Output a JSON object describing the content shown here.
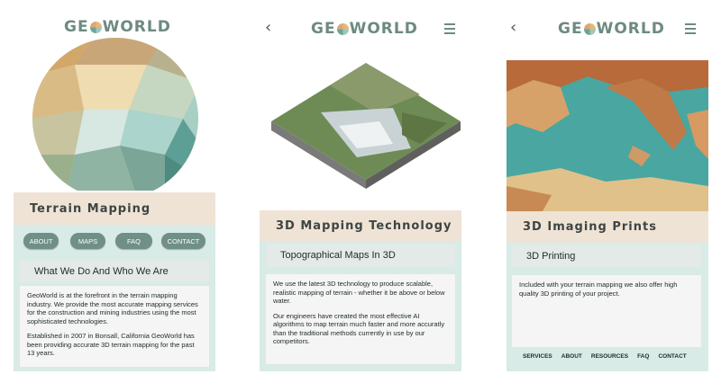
{
  "brand": {
    "prefix": "GE",
    "suffix": "WORLD"
  },
  "screen1": {
    "title": "Terrain Mapping",
    "nav": [
      "ABOUT",
      "MAPS",
      "FAQ",
      "CONTACT"
    ],
    "subheading": "What We Do And Who We Are",
    "paragraphs": [
      "GeoWorld is at the forefront in the terrain mapping industry. We provide the most accurate mapping services for the construction and mining industries using the most sophisticated technologies.",
      "Established in 2007 in Bonsall, California GeoWorld has been providing accurate 3D terrain mapping for the past 13 years."
    ]
  },
  "screen2": {
    "back": "‹",
    "title": "3D Mapping Technology",
    "subheading": "Topographical Maps In 3D",
    "paragraphs": [
      "We use the latest 3D technology to produce scalable, realistic mapping of terrain - whether it be above or below water.",
      "Our engineers have created the most effective AI algorithms to map terrain much faster and more accuratly than the traditional methods currently in use by our competitors."
    ]
  },
  "screen3": {
    "back": "‹",
    "title": "3D Imaging Prints",
    "subheading": "3D Printing",
    "paragraphs": [
      "Included with your terrain mapping we also offer high quality 3D printing of your project."
    ],
    "footer": [
      "SERVICES",
      "ABOUT",
      "RESOURCES",
      "FAQ",
      "CONTACT"
    ]
  }
}
